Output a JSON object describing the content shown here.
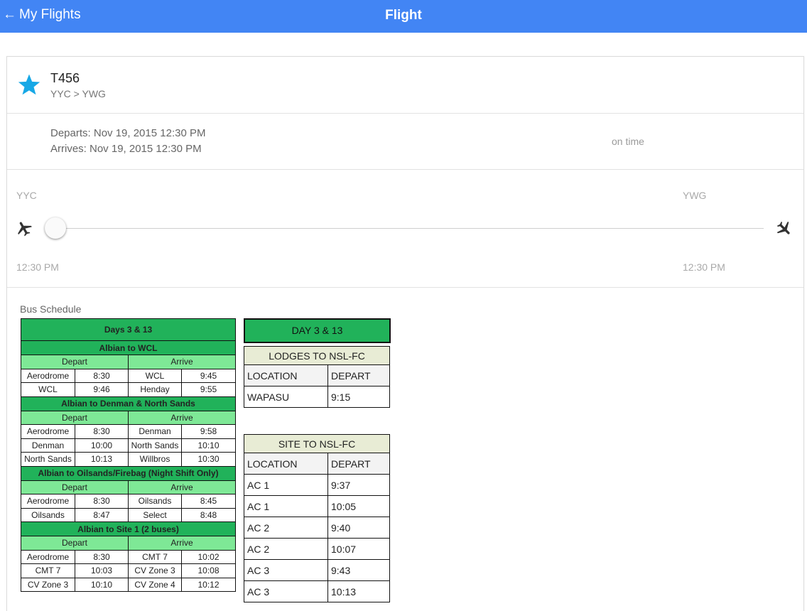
{
  "header": {
    "back_label": "My Flights",
    "title": "Flight"
  },
  "flight": {
    "number": "T456",
    "route": "YYC > YWG",
    "departs": "Departs: Nov 19, 2015 12:30 PM",
    "arrives": "Arrives: Nov 19, 2015 12:30 PM",
    "status": "on time"
  },
  "progress": {
    "origin": "YYC",
    "destination": "YWG",
    "origin_time": "12:30 PM",
    "destination_time": "12:30 PM",
    "fraction": 0.0
  },
  "bus": {
    "title": "Bus Schedule",
    "left_table": {
      "title": "Days 3 & 13",
      "sections": [
        {
          "name": "Albian to WCL",
          "depart": "Depart",
          "arrive": "Arrive",
          "rows": [
            [
              "Aerodrome",
              "8:30",
              "WCL",
              "9:45"
            ],
            [
              "WCL",
              "9:46",
              "Henday",
              "9:55"
            ]
          ]
        },
        {
          "name": "Albian to Denman & North Sands",
          "depart": "Depart",
          "arrive": "Arrive",
          "rows": [
            [
              "Aerodrome",
              "8:30",
              "Denman",
              "9:58"
            ],
            [
              "Denman",
              "10:00",
              "North Sands",
              "10:10"
            ],
            [
              "North Sands",
              "10:13",
              "Willbros",
              "10:30"
            ]
          ]
        },
        {
          "name": "Albian to Oilsands/Firebag (Night Shift Only)",
          "depart": "Depart",
          "arrive": "Arrive",
          "rows": [
            [
              "Aerodrome",
              "8:30",
              "Oilsands",
              "8:45"
            ],
            [
              "Oilsands",
              "8:47",
              "Select",
              "8:48"
            ]
          ]
        },
        {
          "name": "Albian to Site 1 (2 buses)",
          "depart": "Depart",
          "arrive": "Arrive",
          "rows": [
            [
              "Aerodrome",
              "8:30",
              "CMT 7",
              "10:02"
            ],
            [
              "CMT 7",
              "10:03",
              "CV Zone 3",
              "10:08"
            ],
            [
              "CV Zone 3",
              "10:10",
              "CV Zone 4",
              "10:12"
            ]
          ]
        }
      ]
    },
    "right": {
      "day_title": "DAY 3 & 13",
      "lodges": {
        "title": "LODGES TO NSL-FC",
        "col1": "LOCATION",
        "col2": "DEPART",
        "rows": [
          [
            "WAPASU",
            "9:15"
          ]
        ]
      },
      "site": {
        "title": "SITE TO NSL-FC",
        "col1": "LOCATION",
        "col2": "DEPART",
        "rows": [
          [
            "AC 1",
            "9:37"
          ],
          [
            "AC 1",
            "10:05"
          ],
          [
            "AC 2",
            "9:40"
          ],
          [
            "AC 2",
            "10:07"
          ],
          [
            "AC 3",
            "9:43"
          ],
          [
            "AC 3",
            "10:13"
          ]
        ]
      }
    }
  }
}
